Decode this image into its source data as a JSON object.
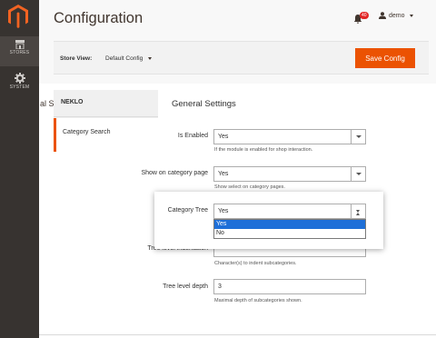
{
  "sidebar": {
    "logo_icon": "magento-logo-icon",
    "items": [
      {
        "label": "STORES",
        "icon": "storefront-icon"
      },
      {
        "label": "SYSTEM",
        "icon": "gear-icon"
      }
    ]
  },
  "header": {
    "title": "Configuration",
    "notifications_count": "40",
    "user_name": "demo"
  },
  "store_bar": {
    "label": "Store View:",
    "value": "Default Config",
    "save_label": "Save Config"
  },
  "tabs": {
    "cut_text": "al S",
    "group": "NEKLO",
    "active_item": "Category Search"
  },
  "section": {
    "title": "General Settings",
    "fields": [
      {
        "label": "Is Enabled",
        "value": "Yes",
        "note": "If the module is enabled for shop interaction."
      },
      {
        "label": "Show on category page",
        "value": "Yes",
        "note": "Show select on category pages."
      },
      {
        "label": "Category Tree",
        "value": "Yes",
        "options": [
          "Yes",
          "No"
        ]
      },
      {
        "label": "Tree level indentation",
        "value": "",
        "note": "Character(s) to indent subcategories."
      },
      {
        "label": "Tree level depth",
        "value": "3",
        "note": "Maximal depth of subcategories shown."
      }
    ]
  },
  "colors": {
    "accent": "#eb5202",
    "sidebar": "#373330",
    "highlight": "#1e6fd8"
  }
}
